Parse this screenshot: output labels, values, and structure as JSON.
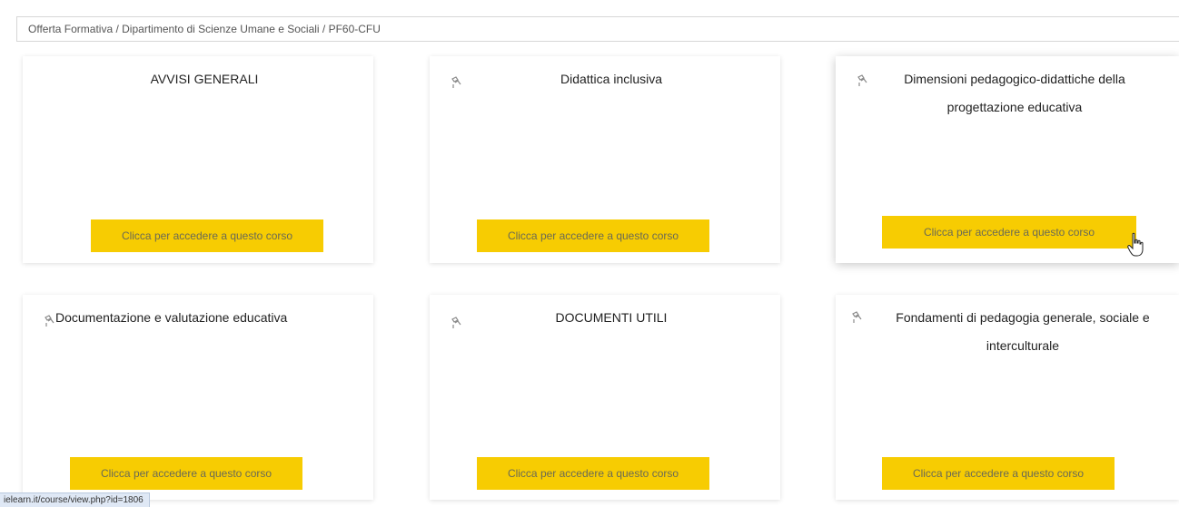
{
  "breadcrumb": {
    "path": "Offerta Formativa / Dipartimento di Scienze Umane e Sociali / PF60-CFU"
  },
  "course_button_label": "Clicca per accedere a questo corso",
  "courses": [
    {
      "title": "AVVISI GENERALI",
      "has_icon": false
    },
    {
      "title": "Didattica inclusiva",
      "has_icon": true,
      "icon": "broken-image-icon"
    },
    {
      "title": "Dimensioni pedagogico-didattiche della progettazione educativa",
      "has_icon": true,
      "icon": "broken-image-icon"
    },
    {
      "title": "Documentazione e valutazione educativa",
      "has_icon": true,
      "icon": "broken-image-icon"
    },
    {
      "title": "DOCUMENTI UTILI",
      "has_icon": true,
      "icon": "broken-image-icon"
    },
    {
      "title": "Fondamenti di pedagogia generale, sociale e interculturale",
      "has_icon": true,
      "icon": "broken-image-icon"
    }
  ],
  "status_bar": {
    "url": "ielearn.it/course/view.php?id=1806"
  },
  "colors": {
    "button_background": "#f7cc02",
    "button_text": "#6a6a55",
    "card_background": "#ffffff",
    "status_bar_background": "#dfe8f5"
  }
}
